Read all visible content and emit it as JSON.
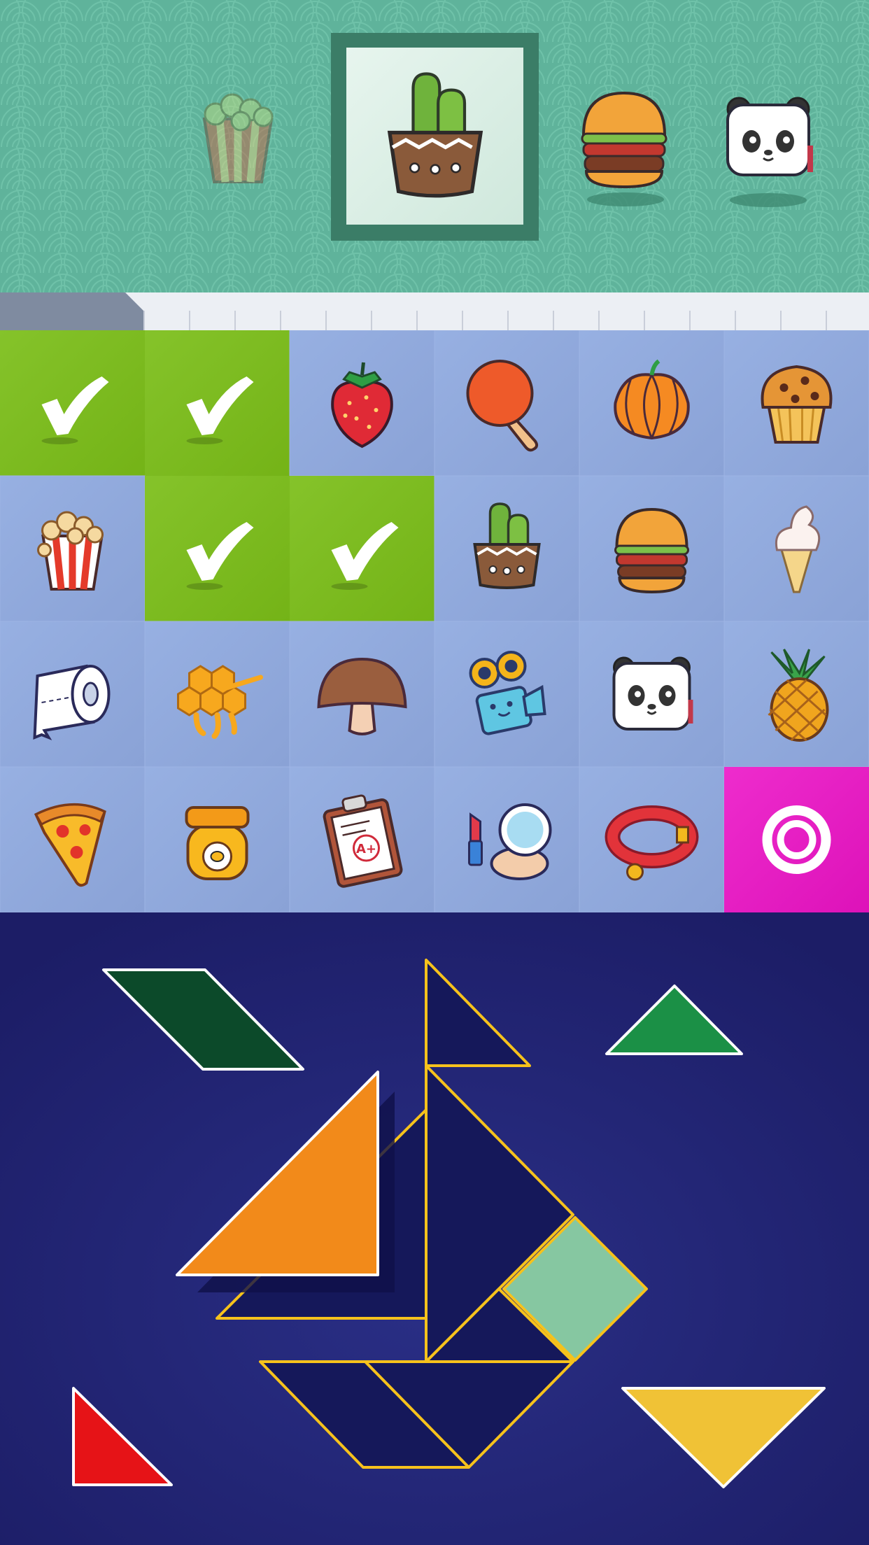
{
  "colors": {
    "top_background": "#5fb39b",
    "tray_teal_border": "#3b7d67",
    "tile_grid_blue": "#8ea7db",
    "matched_green": "#7ebd1f",
    "selected_magenta": "#e61ac3",
    "puzzle_background": "#22236e",
    "outline_yellow": "#f6c21c",
    "piece_dark_green": "#0c4a2a",
    "piece_green": "#1b9046",
    "piece_orange": "#f28a1a",
    "piece_mint": "#86c7a1",
    "piece_red": "#e61317",
    "piece_yellow": "#f0c236"
  },
  "top_tray": {
    "items": [
      {
        "icon": "popcorn-icon",
        "state": "faded"
      },
      {
        "icon": "cactus-icon",
        "state": "selected"
      },
      {
        "icon": "burger-icon",
        "state": "normal"
      },
      {
        "icon": "panda-icon",
        "state": "normal"
      }
    ]
  },
  "progress": {
    "fraction": 0.165
  },
  "grid": {
    "columns": 6,
    "rows": 4,
    "cells": [
      {
        "icon": "check-icon",
        "state": "matched"
      },
      {
        "icon": "check-icon",
        "state": "matched"
      },
      {
        "icon": "strawberry-icon",
        "state": "normal"
      },
      {
        "icon": "ping-pong-paddle-icon",
        "state": "normal"
      },
      {
        "icon": "pumpkin-icon",
        "state": "normal"
      },
      {
        "icon": "muffin-icon",
        "state": "normal"
      },
      {
        "icon": "popcorn-icon",
        "state": "normal"
      },
      {
        "icon": "check-icon",
        "state": "matched"
      },
      {
        "icon": "check-icon",
        "state": "matched"
      },
      {
        "icon": "cactus-icon",
        "state": "normal"
      },
      {
        "icon": "burger-icon",
        "state": "normal"
      },
      {
        "icon": "ice-cream-icon",
        "state": "normal"
      },
      {
        "icon": "toilet-paper-icon",
        "state": "normal"
      },
      {
        "icon": "honeycomb-icon",
        "state": "normal"
      },
      {
        "icon": "mushroom-icon",
        "state": "normal"
      },
      {
        "icon": "camera-icon",
        "state": "normal"
      },
      {
        "icon": "panda-icon",
        "state": "normal"
      },
      {
        "icon": "pineapple-icon",
        "state": "normal"
      },
      {
        "icon": "pizza-icon",
        "state": "normal"
      },
      {
        "icon": "honey-jar-icon",
        "state": "normal"
      },
      {
        "icon": "clipboard-icon",
        "state": "normal"
      },
      {
        "icon": "makeup-icon",
        "state": "normal"
      },
      {
        "icon": "pet-collar-icon",
        "state": "normal"
      },
      {
        "icon": "ring-icon",
        "state": "selected"
      }
    ]
  },
  "clipboard_grade": "A+",
  "tangram": {
    "target_shape": "sailboat",
    "pieces": [
      {
        "shape": "parallelogram",
        "color": "dark-green",
        "placed": false
      },
      {
        "shape": "small-triangle",
        "color": "green",
        "placed": false
      },
      {
        "shape": "large-triangle",
        "color": "orange",
        "placed": false
      },
      {
        "shape": "square",
        "color": "mint",
        "placed": true
      },
      {
        "shape": "small-triangle",
        "color": "red",
        "placed": false
      },
      {
        "shape": "medium-triangle",
        "color": "yellow",
        "placed": false
      }
    ]
  }
}
